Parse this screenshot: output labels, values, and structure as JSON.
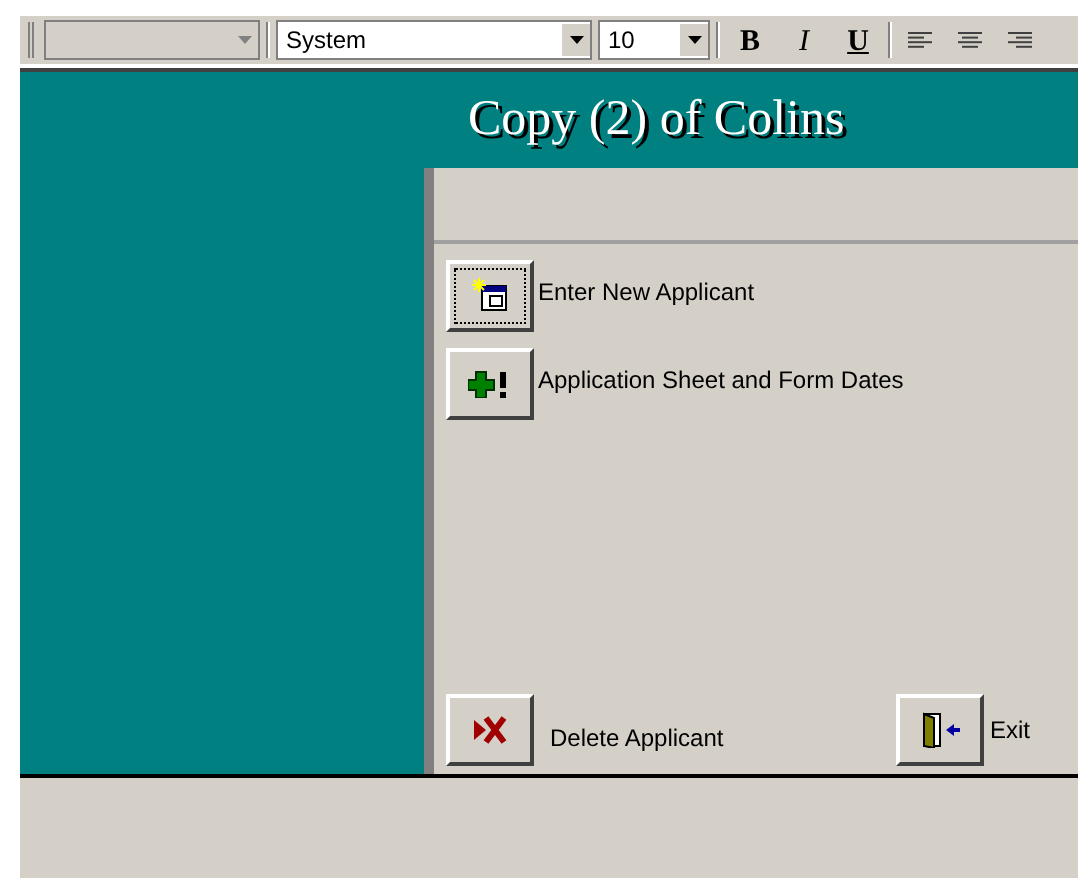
{
  "toolbar": {
    "style_combo": {
      "disabled": true
    },
    "font_combo": {
      "value": "System"
    },
    "size_combo": {
      "value": "10"
    },
    "format_buttons": [
      {
        "label": "B",
        "kind": "bold"
      },
      {
        "label": "I",
        "kind": "italic"
      },
      {
        "label": "U",
        "kind": "underline"
      }
    ],
    "align_buttons": [
      {
        "kind": "left"
      },
      {
        "kind": "center"
      },
      {
        "kind": "right"
      }
    ]
  },
  "form": {
    "title": "Copy (2) of Colins",
    "buttons": [
      {
        "label": "Enter New Applicant",
        "kind": "new",
        "focused": true
      },
      {
        "label": "Application Sheet and Form Dates",
        "kind": "plus",
        "focused": false
      }
    ],
    "bottom_buttons": [
      {
        "label": "Delete Applicant",
        "kind": "delete"
      },
      {
        "label": "Exit",
        "kind": "exit"
      }
    ]
  }
}
